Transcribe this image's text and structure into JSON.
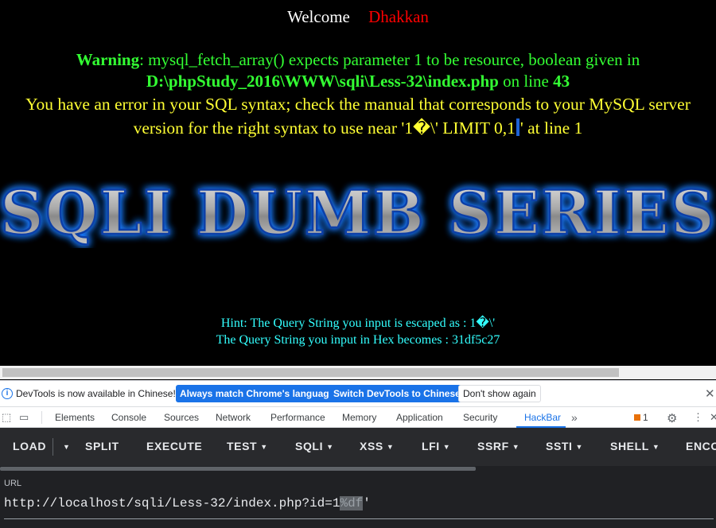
{
  "page": {
    "welcome_label": "Welcome",
    "username": "Dhakkan",
    "warning": {
      "label": "Warning",
      "text": ": mysql_fetch_array() expects parameter 1 to be resource, boolean given in",
      "path": "D:\\phpStudy_2016\\WWW\\sqli\\Less-32\\index.php",
      "on_line": " on line ",
      "line": "43"
    },
    "sql_error_part1": "You have an error in your SQL syntax; check the manual that corresponds to your MySQL server version for the right syntax to use near '1�\\' LIMIT 0,1",
    "sql_error_part2": "' at line 1",
    "banner_text": "SQLI DUMB SERIES",
    "hint_escaped": "Hint: The Query String you input is escaped as : 1�\\'",
    "hint_hex": "The Query String you input in Hex becomes : 31df5c27",
    "colors": {
      "welcome": "#ffffff",
      "username": "#ff0000",
      "warning": "#33ff33",
      "error": "#ffff33",
      "hint": "#33ffff"
    }
  },
  "infobar": {
    "message": "DevTools is now available in Chinese!",
    "btn_match": "Always match Chrome's language",
    "btn_switch": "Switch DevTools to Chinese",
    "btn_dismiss": "Don't show again"
  },
  "devtools_tabs": [
    "Elements",
    "Console",
    "Sources",
    "Network",
    "Performance",
    "Memory",
    "Application",
    "Security",
    "HackBar"
  ],
  "devtools_active_tab": "HackBar",
  "issues_count": "1",
  "hackbar": {
    "menu": [
      {
        "label": "LOAD"
      },
      {
        "label": "SPLIT"
      },
      {
        "label": "EXECUTE"
      },
      {
        "label": "TEST"
      },
      {
        "label": "SQLI"
      },
      {
        "label": "XSS"
      },
      {
        "label": "LFI"
      },
      {
        "label": "SSRF"
      },
      {
        "label": "SSTI"
      },
      {
        "label": "SHELL"
      },
      {
        "label": "ENCO"
      }
    ],
    "url_label": "URL",
    "url_prefix": "http://localhost/sqli/Less-32/index.php?id=1",
    "url_selected": "%df",
    "url_suffix": "'"
  }
}
